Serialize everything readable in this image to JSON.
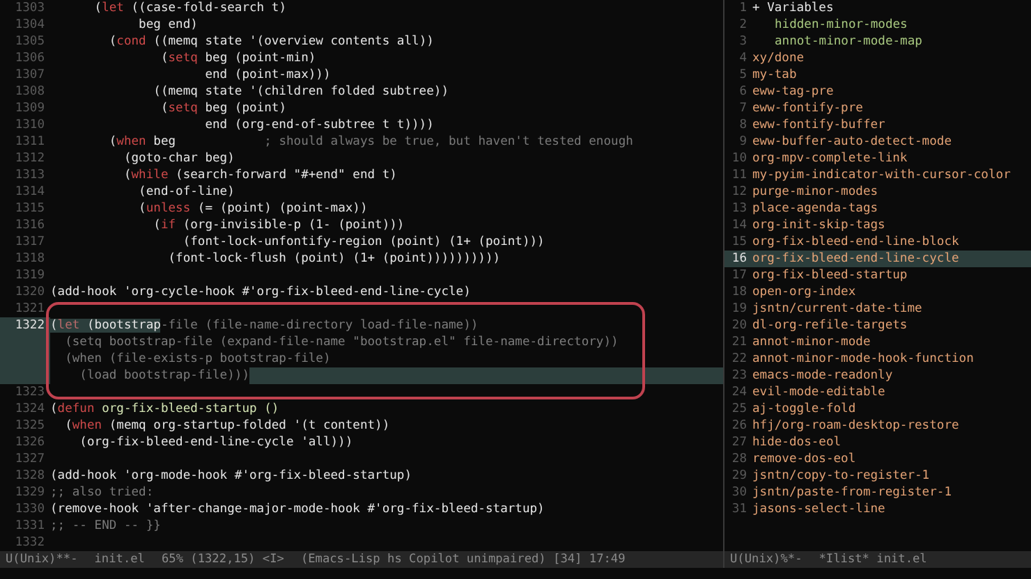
{
  "editor": {
    "lines": [
      {
        "number": "1303",
        "segments": [
          {
            "text": "      (",
            "kind": "plain"
          },
          {
            "text": "let",
            "kind": "keyword"
          },
          {
            "text": " ((case-fold-search t)",
            "kind": "plain"
          }
        ]
      },
      {
        "number": "1304",
        "segments": [
          {
            "text": "            beg end)",
            "kind": "plain"
          }
        ]
      },
      {
        "number": "1305",
        "segments": [
          {
            "text": "        (",
            "kind": "plain"
          },
          {
            "text": "cond",
            "kind": "keyword"
          },
          {
            "text": " ((memq state '(overview contents all))",
            "kind": "plain"
          }
        ]
      },
      {
        "number": "1306",
        "segments": [
          {
            "text": "               (",
            "kind": "plain"
          },
          {
            "text": "setq",
            "kind": "keyword"
          },
          {
            "text": " beg (point-min)",
            "kind": "plain"
          }
        ]
      },
      {
        "number": "1307",
        "segments": [
          {
            "text": "                     end (point-max)))",
            "kind": "plain"
          }
        ]
      },
      {
        "number": "1308",
        "segments": [
          {
            "text": "              ((memq state '(children folded subtree))",
            "kind": "plain"
          }
        ]
      },
      {
        "number": "1309",
        "segments": [
          {
            "text": "               (",
            "kind": "plain"
          },
          {
            "text": "setq",
            "kind": "keyword"
          },
          {
            "text": " beg (point)",
            "kind": "plain"
          }
        ]
      },
      {
        "number": "1310",
        "segments": [
          {
            "text": "                     end (org-end-of-subtree t t))))",
            "kind": "plain"
          }
        ]
      },
      {
        "number": "1311",
        "segments": [
          {
            "text": "        (",
            "kind": "plain"
          },
          {
            "text": "when",
            "kind": "keyword"
          },
          {
            "text": " beg            ",
            "kind": "plain"
          },
          {
            "text": "; should always be true, but haven't tested enough",
            "kind": "comment"
          }
        ]
      },
      {
        "number": "1312",
        "segments": [
          {
            "text": "          (goto-char beg)",
            "kind": "plain"
          }
        ]
      },
      {
        "number": "1313",
        "segments": [
          {
            "text": "          (",
            "kind": "plain"
          },
          {
            "text": "while",
            "kind": "keyword"
          },
          {
            "text": " (search-forward \"#+end\" end t)",
            "kind": "plain"
          }
        ]
      },
      {
        "number": "1314",
        "segments": [
          {
            "text": "            (end-of-line)",
            "kind": "plain"
          }
        ]
      },
      {
        "number": "1315",
        "segments": [
          {
            "text": "            (",
            "kind": "plain"
          },
          {
            "text": "unless",
            "kind": "keyword"
          },
          {
            "text": " (= (point) (point-max))",
            "kind": "plain"
          }
        ]
      },
      {
        "number": "1316",
        "segments": [
          {
            "text": "              (",
            "kind": "plain"
          },
          {
            "text": "if",
            "kind": "keyword"
          },
          {
            "text": " (org-invisible-p (1- (point)))",
            "kind": "plain"
          }
        ]
      },
      {
        "number": "1317",
        "segments": [
          {
            "text": "                  (font-lock-unfontify-region (point) (1+ (point)))",
            "kind": "plain"
          }
        ]
      },
      {
        "number": "1318",
        "segments": [
          {
            "text": "                (font-lock-flush (point) (1+ (point))))))))))",
            "kind": "plain"
          }
        ]
      },
      {
        "number": "1319"
      },
      {
        "number": "1320",
        "segments": [
          {
            "text": "(add-hook 'org-cycle-hook #'org-fix-bleed-end-line-cycle)",
            "kind": "plain"
          }
        ]
      },
      {
        "number": "1321"
      },
      {
        "number": "1322",
        "current": true,
        "segments": [
          {
            "text": "(",
            "kind": "region"
          },
          {
            "text": "let",
            "kind": "region-keyword"
          },
          {
            "text": " (bootstrap",
            "kind": "region"
          },
          {
            "text": "-file (file-name-directory load-file-name))",
            "kind": "dim"
          }
        ]
      },
      {
        "current": true,
        "segments": [
          {
            "text": "  (setq bootstrap-file (expand-file-name \"bootstrap.el\" file-name-directory))",
            "kind": "dim"
          }
        ]
      },
      {
        "current": true,
        "segments": [
          {
            "text": "  (when (file-exists-p bootstrap-file)",
            "kind": "dim"
          }
        ]
      },
      {
        "current": true,
        "trailing_highlight": true,
        "segments": [
          {
            "text": "    (load bootstrap-file)))",
            "kind": "dim"
          }
        ]
      },
      {
        "number": "1323"
      },
      {
        "number": "1324",
        "segments": [
          {
            "text": "(",
            "kind": "plain"
          },
          {
            "text": "defun",
            "kind": "keyword"
          },
          {
            "text": " org-fix-bleed-startup ()",
            "kind": "function"
          }
        ]
      },
      {
        "number": "1325",
        "segments": [
          {
            "text": "  (",
            "kind": "plain"
          },
          {
            "text": "when",
            "kind": "keyword"
          },
          {
            "text": " (memq org-startup-folded '(t content))",
            "kind": "plain"
          }
        ]
      },
      {
        "number": "1326",
        "segments": [
          {
            "text": "    (org-fix-bleed-end-line-cycle 'all)))",
            "kind": "plain"
          }
        ]
      },
      {
        "number": "1327"
      },
      {
        "number": "1328",
        "segments": [
          {
            "text": "(add-hook 'org-mode-hook #'org-fix-bleed-startup)",
            "kind": "plain"
          }
        ]
      },
      {
        "number": "1329",
        "segments": [
          {
            "text": ";; also tried:",
            "kind": "comment"
          }
        ]
      },
      {
        "number": "1330",
        "segments": [
          {
            "text": "(remove-hook 'after-change-major-mode-hook #'org-fix-bleed-startup)",
            "kind": "plain"
          }
        ]
      },
      {
        "number": "1331",
        "segments": [
          {
            "text": ";; -- END -- }}",
            "kind": "comment"
          }
        ]
      },
      {
        "number": "1332"
      }
    ],
    "mode_line": [
      "U(Unix)**-",
      "init.el",
      "65% (1322,15) <I>",
      "(Emacs-Lisp hs Copilot unimpaired) [34] 17:49"
    ]
  },
  "imenu": {
    "items": [
      {
        "number": "1",
        "label": "+ Variables",
        "kind": "group",
        "selected": false,
        "children": [
          {
            "number": "2",
            "label": "hidden-minor-modes",
            "kind": "variable",
            "selected": false
          },
          {
            "number": "3",
            "label": "annot-minor-mode-map",
            "kind": "variable",
            "selected": false
          }
        ]
      },
      {
        "number": "4",
        "label": "xy/done",
        "kind": "function",
        "selected": false
      },
      {
        "number": "5",
        "label": "my-tab",
        "kind": "function",
        "selected": false
      },
      {
        "number": "6",
        "label": "eww-tag-pre",
        "kind": "function",
        "selected": false
      },
      {
        "number": "7",
        "label": "eww-fontify-pre",
        "kind": "function",
        "selected": false
      },
      {
        "number": "8",
        "label": "eww-fontify-buffer",
        "kind": "function",
        "selected": false
      },
      {
        "number": "9",
        "label": "eww-buffer-auto-detect-mode",
        "kind": "function",
        "selected": false
      },
      {
        "number": "10",
        "label": "org-mpv-complete-link",
        "kind": "function",
        "selected": false
      },
      {
        "number": "11",
        "label": "my-pyim-indicator-with-cursor-color",
        "kind": "function",
        "selected": false
      },
      {
        "number": "12",
        "label": "purge-minor-modes",
        "kind": "function",
        "selected": false
      },
      {
        "number": "13",
        "label": "place-agenda-tags",
        "kind": "function",
        "selected": false
      },
      {
        "number": "14",
        "label": "org-init-skip-tags",
        "kind": "function",
        "selected": false
      },
      {
        "number": "15",
        "label": "org-fix-bleed-end-line-block",
        "kind": "function",
        "selected": false
      },
      {
        "number": "16",
        "label": "org-fix-bleed-end-line-cycle",
        "kind": "function",
        "selected": true
      },
      {
        "number": "17",
        "label": "org-fix-bleed-startup",
        "kind": "function",
        "selected": false
      },
      {
        "number": "18",
        "label": "open-org-index",
        "kind": "function",
        "selected": false
      },
      {
        "number": "19",
        "label": "jsntn/current-date-time",
        "kind": "function",
        "selected": false
      },
      {
        "number": "20",
        "label": "dl-org-refile-targets",
        "kind": "function",
        "selected": false
      },
      {
        "number": "21",
        "label": "annot-minor-mode",
        "kind": "function",
        "selected": false
      },
      {
        "number": "22",
        "label": "annot-minor-mode-hook-function",
        "kind": "function",
        "selected": false
      },
      {
        "number": "23",
        "label": "emacs-mode-readonly",
        "kind": "function",
        "selected": false
      },
      {
        "number": "24",
        "label": "evil-mode-editable",
        "kind": "function",
        "selected": false
      },
      {
        "number": "25",
        "label": "aj-toggle-fold",
        "kind": "function",
        "selected": false
      },
      {
        "number": "26",
        "label": "hfj/org-roam-desktop-restore",
        "kind": "function",
        "selected": false
      },
      {
        "number": "27",
        "label": "hide-dos-eol",
        "kind": "function",
        "selected": false
      },
      {
        "number": "28",
        "label": "remove-dos-eol",
        "kind": "function",
        "selected": false
      },
      {
        "number": "29",
        "label": "jsntn/copy-to-register-1",
        "kind": "function",
        "selected": false
      },
      {
        "number": "30",
        "label": "jsntn/paste-from-register-1",
        "kind": "function",
        "selected": false
      },
      {
        "number": "31",
        "label": "jasons-select-line",
        "kind": "function",
        "selected": false
      }
    ],
    "mode_line": [
      "U(Unix)%*-",
      "*Ilist* init.el"
    ]
  }
}
